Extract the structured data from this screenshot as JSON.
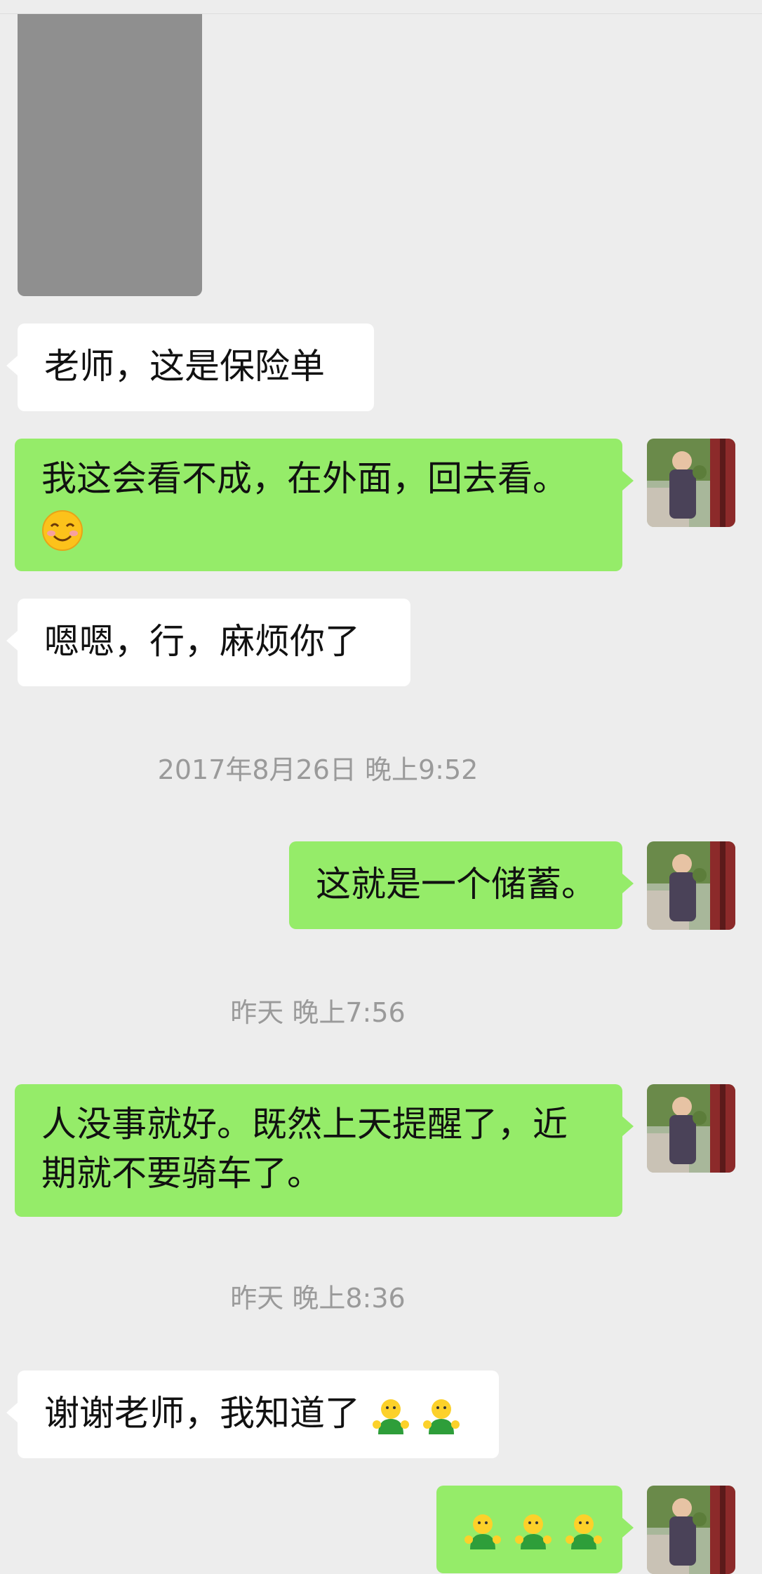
{
  "messages": {
    "m1_text": "老师，这是保险单",
    "m2_text": "我这会看不成，在外面，回去看。",
    "m2_emoji": "smiling-face-emoji",
    "m3_text": "嗯嗯，行，麻烦你了",
    "ts1": "2017年8月26日 晚上9:52",
    "m4_text": "这就是一个储蓄。",
    "ts2": "昨天 晚上7:56",
    "m5_line1": "人没事就好。既然上天提醒了，近",
    "m5_line2": "期就不要骑车了。",
    "ts3": "昨天 晚上8:36",
    "m6_text": "谢谢老师，我知道了",
    "m6_emoji": "thumbs-up-person-emoji",
    "m7_emoji": "thumbs-up-person-emoji"
  },
  "colors": {
    "outgoing_bubble": "#95ec69",
    "incoming_bubble": "#ffffff",
    "background": "#ededed"
  }
}
